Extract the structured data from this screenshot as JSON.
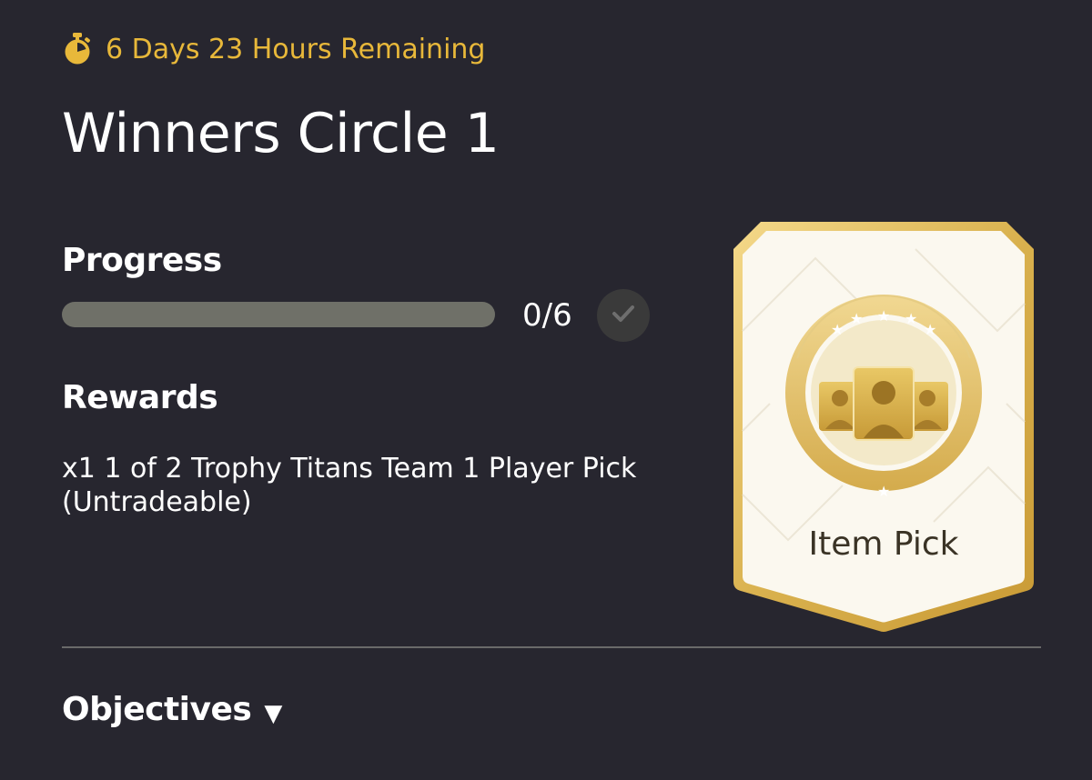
{
  "timer": {
    "icon": "stopwatch-icon",
    "text": "6 Days 23 Hours Remaining",
    "color": "#e8b83a"
  },
  "title": "Winners Circle 1",
  "progress": {
    "heading": "Progress",
    "count_text": "0/6",
    "completed": 0,
    "total": 6,
    "fraction": 0,
    "check_icon": "checkmark-icon"
  },
  "rewards": {
    "heading": "Rewards",
    "description": "x1 1 of 2 Trophy Titans Team 1 Player Pick (Untradeable)",
    "card": {
      "label": "Item Pick",
      "icon": "player-pick-icon"
    }
  },
  "objectives": {
    "label": "Objectives",
    "toggle_glyph": "▼",
    "icon": "chevron-down-icon"
  },
  "colors": {
    "background": "#27262f",
    "accent_gold": "#e8b83a",
    "progress_track": "#6f7068",
    "text": "#ffffff"
  }
}
